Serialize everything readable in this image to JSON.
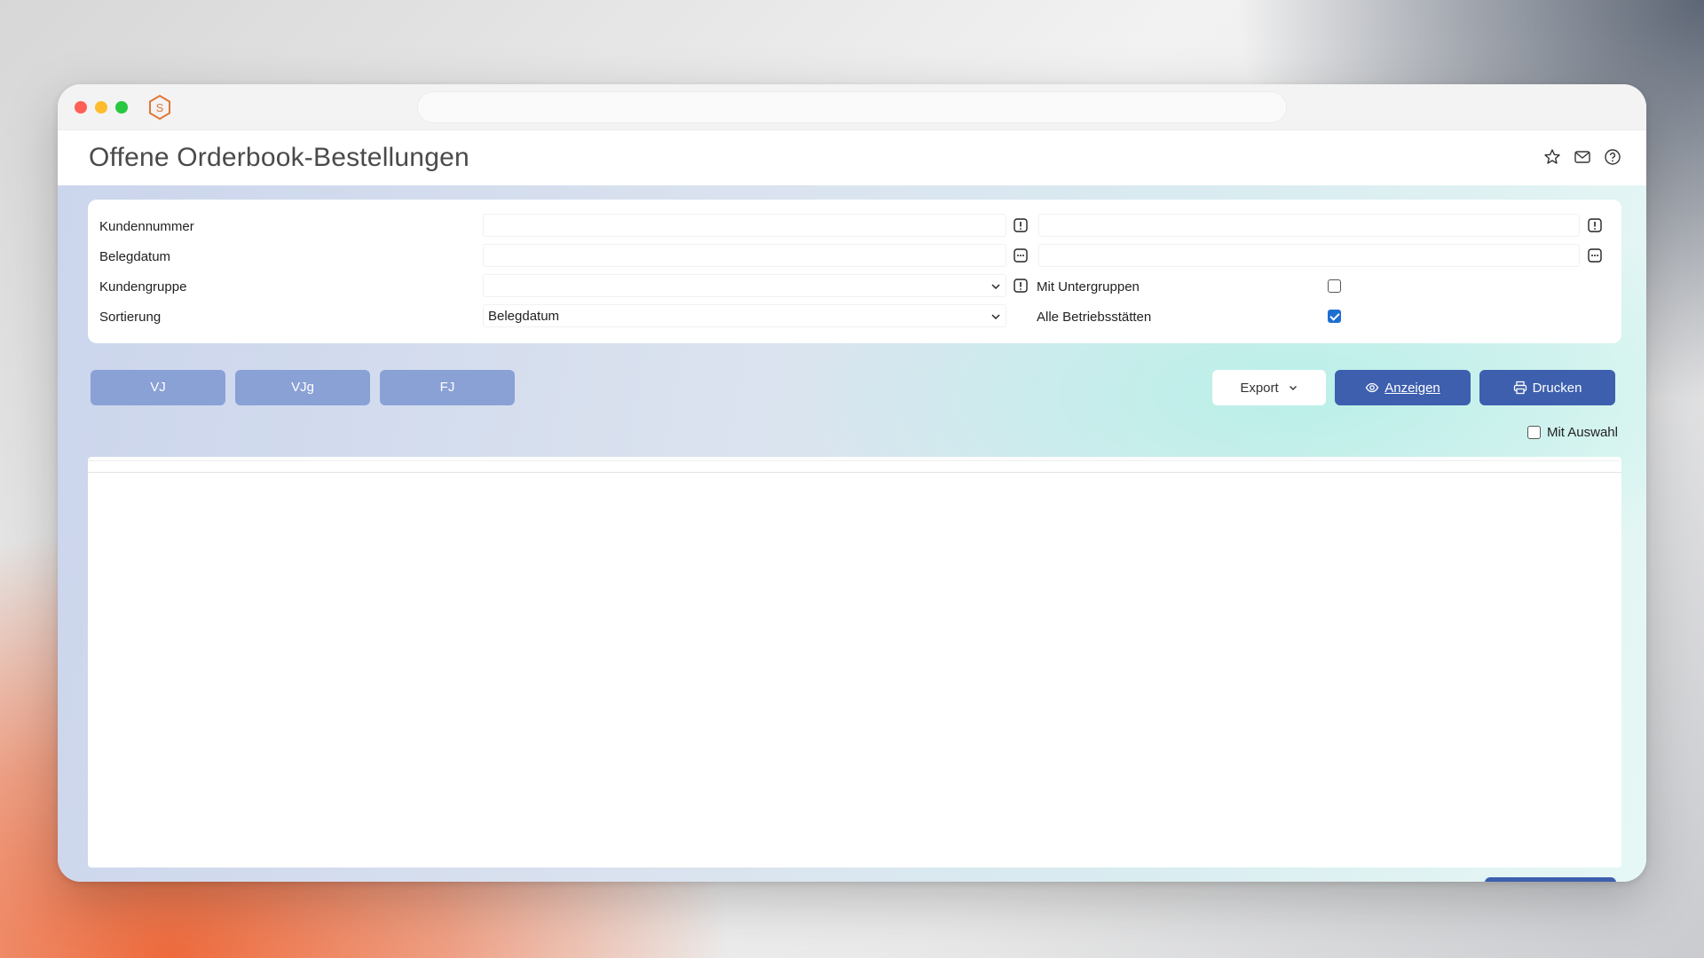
{
  "window": {
    "title": "Offene Orderbook-Bestellungen",
    "logo_icon": "hexagon-s-logo",
    "title_icons": [
      "star-icon",
      "mail-icon",
      "help-icon"
    ]
  },
  "filters": {
    "kundennummer": {
      "label": "Kundennummer",
      "from": "",
      "to": "",
      "icon": "alert-square-icon"
    },
    "belegdatum": {
      "label": "Belegdatum",
      "from": "",
      "to": "",
      "icon": "calendar-dots-icon"
    },
    "kundengruppe": {
      "label": "Kundengruppe",
      "value": "",
      "icon": "alert-square-icon"
    },
    "sortierung": {
      "label": "Sortierung",
      "value": "Belegdatum"
    },
    "mit_untergruppen": {
      "label": "Mit Untergruppen",
      "checked": false
    },
    "alle_betriebsstaetten": {
      "label": "Alle Betriebsstätten",
      "checked": true
    }
  },
  "quick_buttons": [
    "VJ",
    "VJg",
    "FJ"
  ],
  "actions": {
    "export_label": "Export",
    "anzeigen_label": "Anzeigen",
    "drucken_label": "Drucken"
  },
  "mit_auswahl": {
    "label": "Mit Auswahl",
    "checked": false
  },
  "colors": {
    "primary": "#3d5fae",
    "quick_button": "#8aa1d6",
    "checkbox_checked": "#1f6fd1"
  }
}
